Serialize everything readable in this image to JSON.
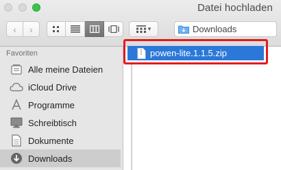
{
  "window": {
    "title": "Datei hochladen"
  },
  "toolbar": {
    "back_symbol": "‹",
    "forward_symbol": "›",
    "view_modes": [
      "icon-view-icon",
      "list-view-icon",
      "column-view-icon",
      "coverflow-view-icon"
    ],
    "active_view": "column-view-icon",
    "arrange_icon": "arrange-grid-icon",
    "location": "Downloads"
  },
  "sidebar": {
    "header": "Favoriten",
    "items": [
      {
        "label": "Alle meine Dateien",
        "icon": "all-files-icon"
      },
      {
        "label": "iCloud Drive",
        "icon": "cloud-icon"
      },
      {
        "label": "Programme",
        "icon": "applications-icon"
      },
      {
        "label": "Schreibtisch",
        "icon": "desktop-icon"
      },
      {
        "label": "Dokumente",
        "icon": "document-icon"
      },
      {
        "label": "Downloads",
        "icon": "downloads-icon",
        "selected": true
      }
    ]
  },
  "files": [
    {
      "name": "powen-lite.1.1.5.zip",
      "selected": true
    }
  ],
  "colors": {
    "selection": "#2b78d9",
    "highlight_box": "#e51a1a",
    "sidebar_bg": "#e6e6e6"
  }
}
